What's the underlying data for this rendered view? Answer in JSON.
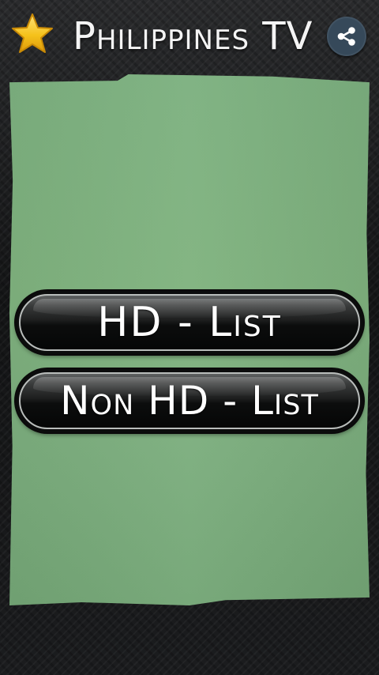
{
  "header": {
    "title": "Philippines TV",
    "favorite_icon": "star-icon",
    "share_icon": "share-icon"
  },
  "main": {
    "buttons": [
      {
        "label": "HD - List"
      },
      {
        "label": "Non HD - List"
      }
    ]
  },
  "colors": {
    "background": "#1e1f21",
    "panel_green": "#7db180",
    "share_circle": "#36495a",
    "star_gold": "#f5c21b",
    "button_black": "#0b0c0c",
    "text_white": "#ffffff"
  }
}
